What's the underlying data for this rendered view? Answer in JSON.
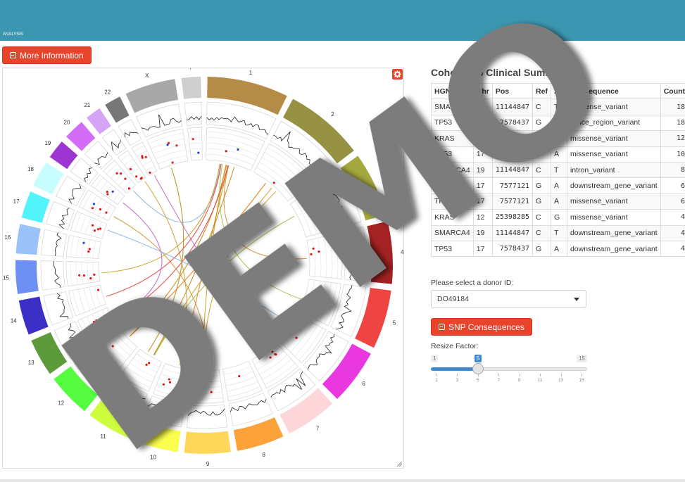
{
  "header": {
    "subtitle": "ANALYSIS"
  },
  "buttons": {
    "more_info": "More Information",
    "snp_consequences": "SNP Consequences"
  },
  "circos": {
    "chromosomes": [
      "1",
      "2",
      "3",
      "4",
      "5",
      "6",
      "7",
      "8",
      "9",
      "10",
      "11",
      "12",
      "13",
      "14",
      "15",
      "16",
      "17",
      "18",
      "19",
      "20",
      "21",
      "22",
      "X",
      "Y"
    ],
    "colors": [
      "#b58b48",
      "#979144",
      "#a4a83d",
      "#a42223",
      "#ee4542",
      "#ea38e0",
      "#fdd6da",
      "#fba33a",
      "#fed65a",
      "#fbfe4e",
      "#cefd3e",
      "#55fc40",
      "#5d9b3a",
      "#3c2fc5",
      "#6d8ef2",
      "#9ac2f9",
      "#53f3fb",
      "#c8fdfd",
      "#9d35d2",
      "#d36cf6",
      "#d5a4f6",
      "#777777",
      "#a8a8a8",
      "#cfcfcf"
    ]
  },
  "table": {
    "title": "Cohort Top Clinical Summary:",
    "columns": [
      "HGNC",
      "Chr",
      "Pos",
      "Ref",
      "Alt",
      "Consequence",
      "Count"
    ],
    "rows": [
      [
        "SMARCA4",
        "19",
        "11144847",
        "C",
        "T",
        "missense_variant",
        "18"
      ],
      [
        "TP53",
        "17",
        "7578437",
        "G",
        "A",
        "splice_region_variant",
        "18"
      ],
      [
        "KRAS",
        "12",
        "25398284",
        "C",
        "A",
        "missense_variant",
        "12"
      ],
      [
        "TP53",
        "17",
        "7578437",
        "G",
        "A",
        "missense_variant",
        "10"
      ],
      [
        "SMARCA4",
        "19",
        "11144847",
        "C",
        "T",
        "intron_variant",
        "8"
      ],
      [
        "TP53",
        "17",
        "7577121",
        "G",
        "A",
        "downstream_gene_variant",
        "6"
      ],
      [
        "TP53",
        "17",
        "7577121",
        "G",
        "A",
        "missense_variant",
        "6"
      ],
      [
        "KRAS",
        "12",
        "25398285",
        "C",
        "G",
        "missense_variant",
        "4"
      ],
      [
        "SMARCA4",
        "19",
        "11144847",
        "C",
        "T",
        "downstream_gene_variant",
        "4"
      ],
      [
        "TP53",
        "17",
        "7578437",
        "G",
        "A",
        "downstream_gene_variant",
        "4"
      ]
    ]
  },
  "donor": {
    "label": "Please select a donor ID:",
    "value": "DO49184"
  },
  "slider": {
    "label": "Resize Factor:",
    "min": 1,
    "max": 15,
    "value": 5,
    "ticks": [
      "1",
      "3",
      "5",
      "7",
      "9",
      "11",
      "13",
      "15"
    ]
  },
  "watermark": {
    "text": "DEMO"
  }
}
